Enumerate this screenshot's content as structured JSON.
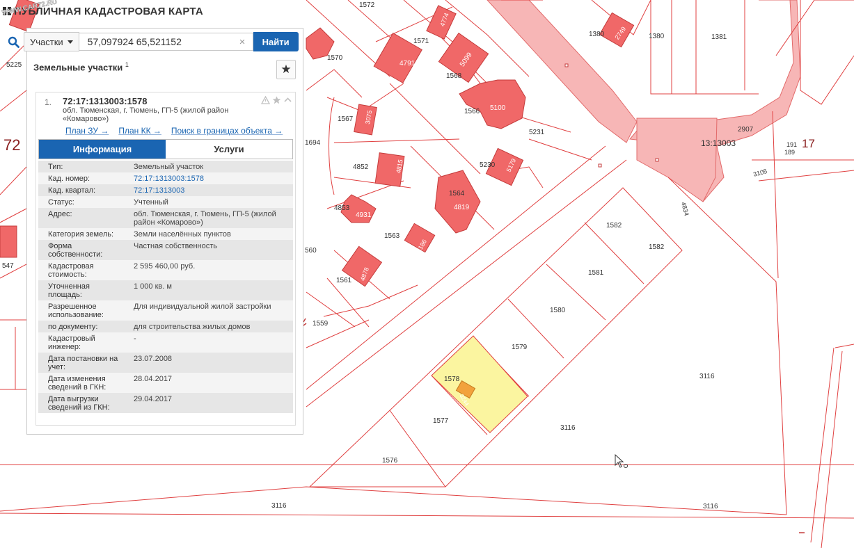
{
  "header": {
    "title": "ПУБЛИЧНАЯ КАДАСТРОВАЯ КАРТА",
    "watermark": "WWW.CAR72.RU"
  },
  "search": {
    "type_label": "Участки",
    "query": "57,097924 65,521152",
    "clear": "×",
    "find_label": "Найти"
  },
  "panel": {
    "heading": "Земельные участки",
    "count": "1",
    "favorite": "★",
    "result": {
      "index": "1.",
      "number": "72:17:1313003:1578",
      "address": "обл. Тюменская, г. Тюмень, ГП-5 (жилой район «Комарово»)",
      "links": {
        "plan_zu": "План ЗУ →",
        "plan_kk": "План КК →",
        "search_bounds": "Поиск в границах объекта →"
      },
      "tabs": {
        "info": "Информация",
        "services": "Услуги"
      },
      "fields": [
        {
          "key": "Тип:",
          "value": "Земельный участок"
        },
        {
          "key": "Кад. номер:",
          "value": "72:17:1313003:1578",
          "link": true
        },
        {
          "key": "Кад. квартал:",
          "value": "72:17:1313003",
          "link": true
        },
        {
          "key": "Статус:",
          "value": "Учтенный"
        },
        {
          "key": "Адрес:",
          "value": "обл. Тюменская, г. Тюмень, ГП-5 (жилой район «Комарово»)"
        },
        {
          "key": "Категория земель:",
          "value": "Земли населённых пунктов"
        },
        {
          "key": "Форма собственности:",
          "value": "Частная собственность"
        },
        {
          "key": "Кадастровая стоимость:",
          "value": "2 595 460,00 руб."
        },
        {
          "key": "Уточненная площадь:",
          "value": "1 000 кв. м"
        },
        {
          "key": "Разрешенное использование:",
          "value": "Для индивидуальной жилой застройки"
        },
        {
          "key": "по документу:",
          "value": "для строительства жилых домов"
        },
        {
          "key": "Кадастровый инженер:",
          "value": "-"
        },
        {
          "key": "Дата постановки на учет:",
          "value": "23.07.2008"
        },
        {
          "key": "Дата изменения сведений в ГКН:",
          "value": "28.04.2017"
        },
        {
          "key": "Дата выгрузки сведений из ГКН:",
          "value": "29.04.2017"
        }
      ]
    }
  },
  "map": {
    "colors": {
      "parcel_line": "#e04040",
      "building_fill": "#f06868",
      "road_fill": "#f7b6b6",
      "selected_fill": "#fbf5a0",
      "selected_building": "#f2a23c"
    },
    "labels": {
      "q5225": "5225",
      "q72": "72",
      "q547": "547",
      "q1572": "1572",
      "q4774": "4774",
      "q1570": "1570",
      "q1571": "1571",
      "q4791": "4791",
      "q5099": "5099",
      "q1568": "1568",
      "q1566": "1566",
      "q5100": "5100",
      "q1380": "1380",
      "q2749": "2749",
      "q1380b": "1380",
      "q1381": "1381",
      "q1567": "1567",
      "q3075": "3075",
      "q1694": "1694",
      "q5231": "5231",
      "q2907": "2907",
      "q13003": "13:13003",
      "q191": "191",
      "q189": "189",
      "q17": "17",
      "q3105": "3105",
      "q4852": "4852",
      "q4815": "4815",
      "q5230": "5230",
      "q5179": "5179",
      "q1564": "1564",
      "q4819": "4819",
      "q4853": "4853",
      "q4931": "4931",
      "q4834": "4834",
      "q1582": "1582",
      "q1582b": "1582",
      "q1563": "1563",
      "q3186": "3186",
      "q560": "560",
      "q1561": "1561",
      "q4878": "4878",
      "q1581": "1581",
      "q1559": "1559",
      "q1580": "1580",
      "q1579": "1579",
      "q1578": "1578",
      "q3244": "3244",
      "q3116a": "3116",
      "q1577": "1577",
      "q3116b": "3116",
      "q1576": "1576",
      "q3116c": "3116",
      "q3116d": "3116"
    }
  }
}
